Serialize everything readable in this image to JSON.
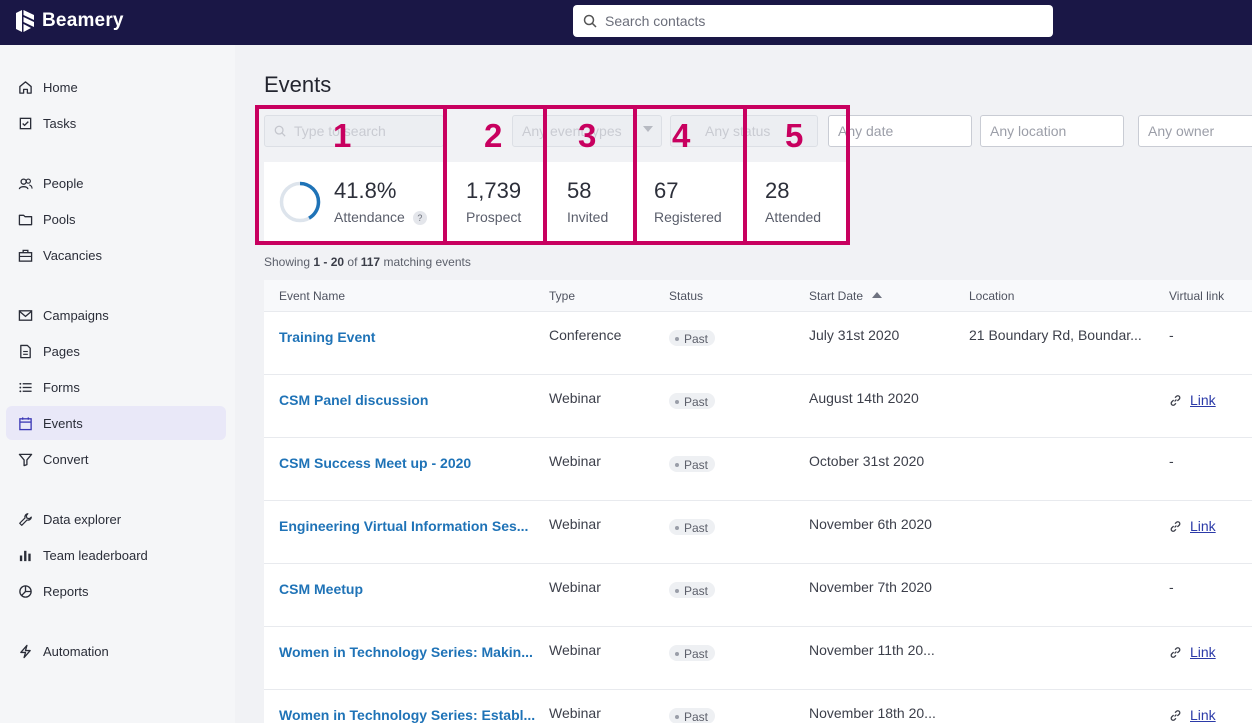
{
  "app": {
    "brand": "Beamery"
  },
  "topbar": {
    "search_placeholder": "Search contacts"
  },
  "sidebar": {
    "items": [
      {
        "label": "Home",
        "icon": "home-icon"
      },
      {
        "label": "Tasks",
        "icon": "tasks-icon"
      },
      {
        "label": "People",
        "icon": "people-icon"
      },
      {
        "label": "Pools",
        "icon": "folder-icon"
      },
      {
        "label": "Vacancies",
        "icon": "briefcase-icon"
      },
      {
        "label": "Campaigns",
        "icon": "mail-icon"
      },
      {
        "label": "Pages",
        "icon": "page-icon"
      },
      {
        "label": "Forms",
        "icon": "list-icon"
      },
      {
        "label": "Events",
        "icon": "calendar-icon",
        "active": true
      },
      {
        "label": "Convert",
        "icon": "filter-icon"
      },
      {
        "label": "Data explorer",
        "icon": "wrench-icon"
      },
      {
        "label": "Team leaderboard",
        "icon": "bar-chart-icon"
      },
      {
        "label": "Reports",
        "icon": "pie-chart-icon"
      },
      {
        "label": "Automation",
        "icon": "lightning-icon"
      }
    ]
  },
  "page": {
    "title": "Events"
  },
  "filters": {
    "search_placeholder": "Type to search",
    "type_placeholder": "Any event types",
    "status_placeholder": "Any status",
    "date_placeholder": "Any date",
    "location_placeholder": "Any location",
    "owner_placeholder": "Any owner"
  },
  "stats": {
    "attendance": {
      "value": "41.8%",
      "label": "Attendance",
      "fraction": 0.418,
      "help": "?"
    },
    "prospect": {
      "value": "1,739",
      "label": "Prospect"
    },
    "invited": {
      "value": "58",
      "label": "Invited"
    },
    "registered": {
      "value": "67",
      "label": "Registered"
    },
    "attended": {
      "value": "28",
      "label": "Attended"
    }
  },
  "highlights": [
    "1",
    "2",
    "3",
    "4",
    "5"
  ],
  "results": {
    "prefix": "Showing ",
    "range": "1 - 20",
    "of": " of ",
    "total": "117",
    "suffix": " matching events"
  },
  "table": {
    "columns": [
      "Event Name",
      "Type",
      "Status",
      "Start Date",
      "Location",
      "Virtual link"
    ],
    "rows": [
      {
        "name": "Training Event",
        "type": "Conference",
        "status": "Past",
        "date": "July 31st 2020",
        "location": "21 Boundary Rd, Boundar...",
        "link": "-"
      },
      {
        "name": "CSM Panel discussion",
        "type": "Webinar",
        "status": "Past",
        "date": "August 14th 2020",
        "location": "",
        "link": "Link"
      },
      {
        "name": "CSM Success Meet up - 2020",
        "type": "Webinar",
        "status": "Past",
        "date": "October 31st 2020",
        "location": "",
        "link": "-"
      },
      {
        "name": "Engineering Virtual Information Ses...",
        "type": "Webinar",
        "status": "Past",
        "date": "November 6th 2020",
        "location": "",
        "link": "Link"
      },
      {
        "name": "CSM Meetup",
        "type": "Webinar",
        "status": "Past",
        "date": "November 7th 2020",
        "location": "",
        "link": "-"
      },
      {
        "name": "Women in Technology Series: Makin...",
        "type": "Webinar",
        "status": "Past",
        "date": "November 11th 20...",
        "location": "",
        "link": "Link"
      },
      {
        "name": "Women in Technology Series: Establ...",
        "type": "Webinar",
        "status": "Past",
        "date": "November 18th 20...",
        "location": "",
        "link": "Link"
      }
    ]
  },
  "colors": {
    "topbar": "#1a1746",
    "highlight": "#c8005f",
    "link": "#1f73b7",
    "ring": "#1f73b7"
  }
}
